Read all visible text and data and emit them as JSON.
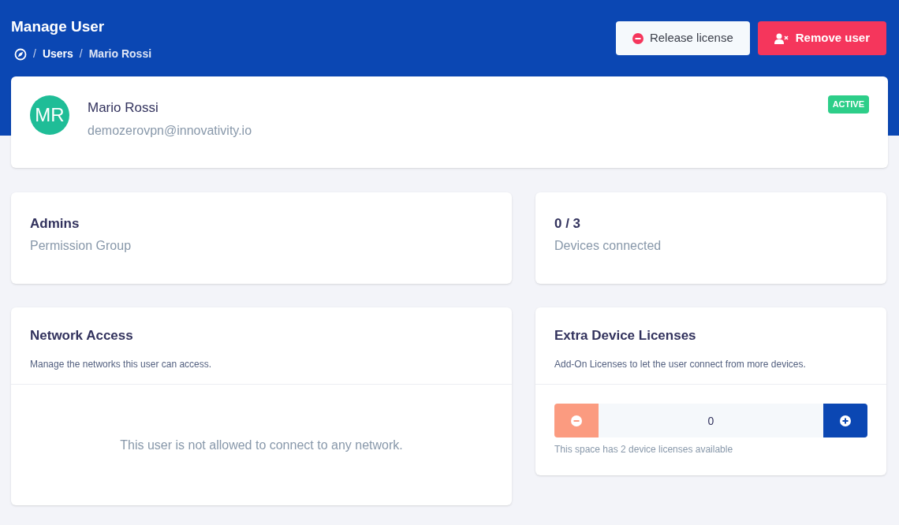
{
  "header": {
    "title": "Manage User",
    "breadcrumb_separator": "/",
    "breadcrumb": [
      "Users",
      "Mario Rossi"
    ],
    "buttons": [
      {
        "kind": "secondary",
        "label": "Release license"
      },
      {
        "kind": "danger",
        "label": "Remove user"
      }
    ]
  },
  "profile": {
    "initials": "MR",
    "name": "Mario Rossi",
    "email": "demozerovpn@innovativity.io",
    "status": "ACTIVE"
  },
  "stats": [
    {
      "value": "Admins",
      "label": "Permission Group"
    },
    {
      "value": "0 / 3",
      "label": "Devices connected"
    }
  ],
  "network_access": {
    "title": "Network Access",
    "description": "Manage the networks this user can access.",
    "empty_message": "This user is not allowed to connect to any network."
  },
  "extra_licenses": {
    "title": "Extra Device Licenses",
    "description": "Add-On Licenses to let the user connect from more devices.",
    "value": "0",
    "decrement_disabled": true,
    "increment_disabled": false,
    "hint": "This space has 2 device licenses available"
  }
}
